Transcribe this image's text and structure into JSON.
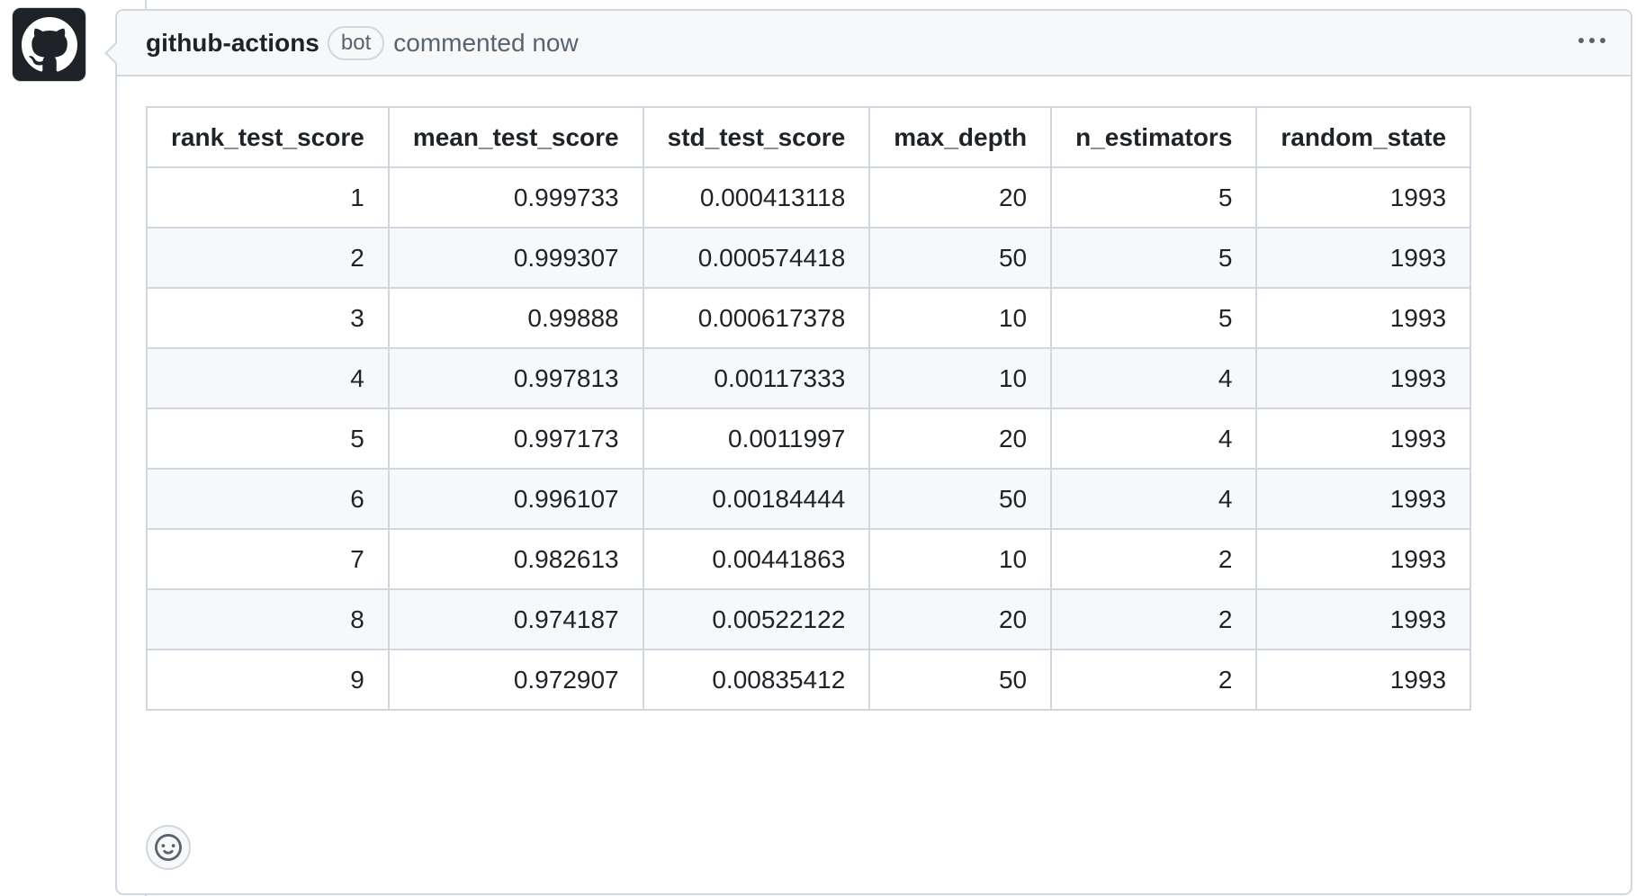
{
  "comment": {
    "author": "github-actions",
    "badge": "bot",
    "timestamp_text": "commented now",
    "avatar_icon": "github-octocat-icon",
    "menu_icon": "kebab-horizontal-icon",
    "reaction_icon": "smiley-icon"
  },
  "table": {
    "headers": [
      "rank_test_score",
      "mean_test_score",
      "std_test_score",
      "max_depth",
      "n_estimators",
      "random_state"
    ],
    "rows": [
      [
        "1",
        "0.999733",
        "0.000413118",
        "20",
        "5",
        "1993"
      ],
      [
        "2",
        "0.999307",
        "0.000574418",
        "50",
        "5",
        "1993"
      ],
      [
        "3",
        "0.99888",
        "0.000617378",
        "10",
        "5",
        "1993"
      ],
      [
        "4",
        "0.997813",
        "0.00117333",
        "10",
        "4",
        "1993"
      ],
      [
        "5",
        "0.997173",
        "0.0011997",
        "20",
        "4",
        "1993"
      ],
      [
        "6",
        "0.996107",
        "0.00184444",
        "50",
        "4",
        "1993"
      ],
      [
        "7",
        "0.982613",
        "0.00441863",
        "10",
        "2",
        "1993"
      ],
      [
        "8",
        "0.974187",
        "0.00522122",
        "20",
        "2",
        "1993"
      ],
      [
        "9",
        "0.972907",
        "0.00835412",
        "50",
        "2",
        "1993"
      ]
    ]
  },
  "colors": {
    "border": "#d0d7de",
    "header_bg": "#f6f8fa",
    "muted_text": "#59636e",
    "text": "#1f2328"
  }
}
